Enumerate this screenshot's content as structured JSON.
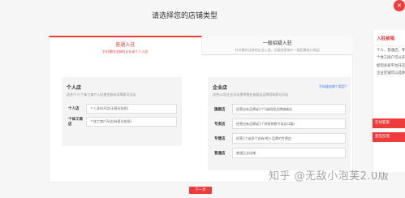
{
  "page_title": "请选择您的店铺类型",
  "tabs": [
    {
      "title": "普通入驻",
      "subtitle": "针对需内注册的企业或个人入驻"
    },
    {
      "title": "一般招疑入驻",
      "subtitle": "针对需内注册的企业入驻，仅限卖家商户一般招募进口商品"
    }
  ],
  "personal_shop": {
    "title": "个人店",
    "desc": "适合个人/个体工商户入驻提供身份证等即可开店",
    "rows": [
      {
        "key": "个人店",
        "value": "个人身份开店(无营业执照)"
      },
      {
        "key": "个体工商店",
        "value": "个体工商户开店(有营业执照)"
      }
    ]
  },
  "enterprise_shop": {
    "title": "企业店",
    "desc": "适合公司/企业开店提供营业执照及品牌资料即可开店",
    "link": "不知道选哪个类型?",
    "rows": [
      {
        "key": "旗舰店",
        "value": "经营自有品牌或1个1级授权品牌旗舰店"
      },
      {
        "key": "专卖店",
        "value": "经营自有品牌或1个授权销售专卖店(2级)"
      },
      {
        "key": "专营店",
        "value": "经营1个或多个自有/他人品牌的专营店"
      },
      {
        "key": "普通店",
        "value": "普通企业店铺"
      }
    ]
  },
  "next_button": "下一步",
  "watermark": "知乎 @无敌小泡芙2.0版",
  "side_panel": {
    "title": "入驻被箱",
    "close_symbol": "×",
    "paragraphs": [
      "个人，普通店，专卖店，专营店，旗舰店，不能提供以下个",
      "个体工商户可以开普通企业店铺店",
      "如何多家平台开店是否需要再",
      "企业店铺可以选择普通企业店"
    ],
    "buttons": [
      "在线客服",
      "意见反馈"
    ]
  },
  "colors": {
    "accent": "#ee3c3c",
    "link": "#3478e6"
  }
}
